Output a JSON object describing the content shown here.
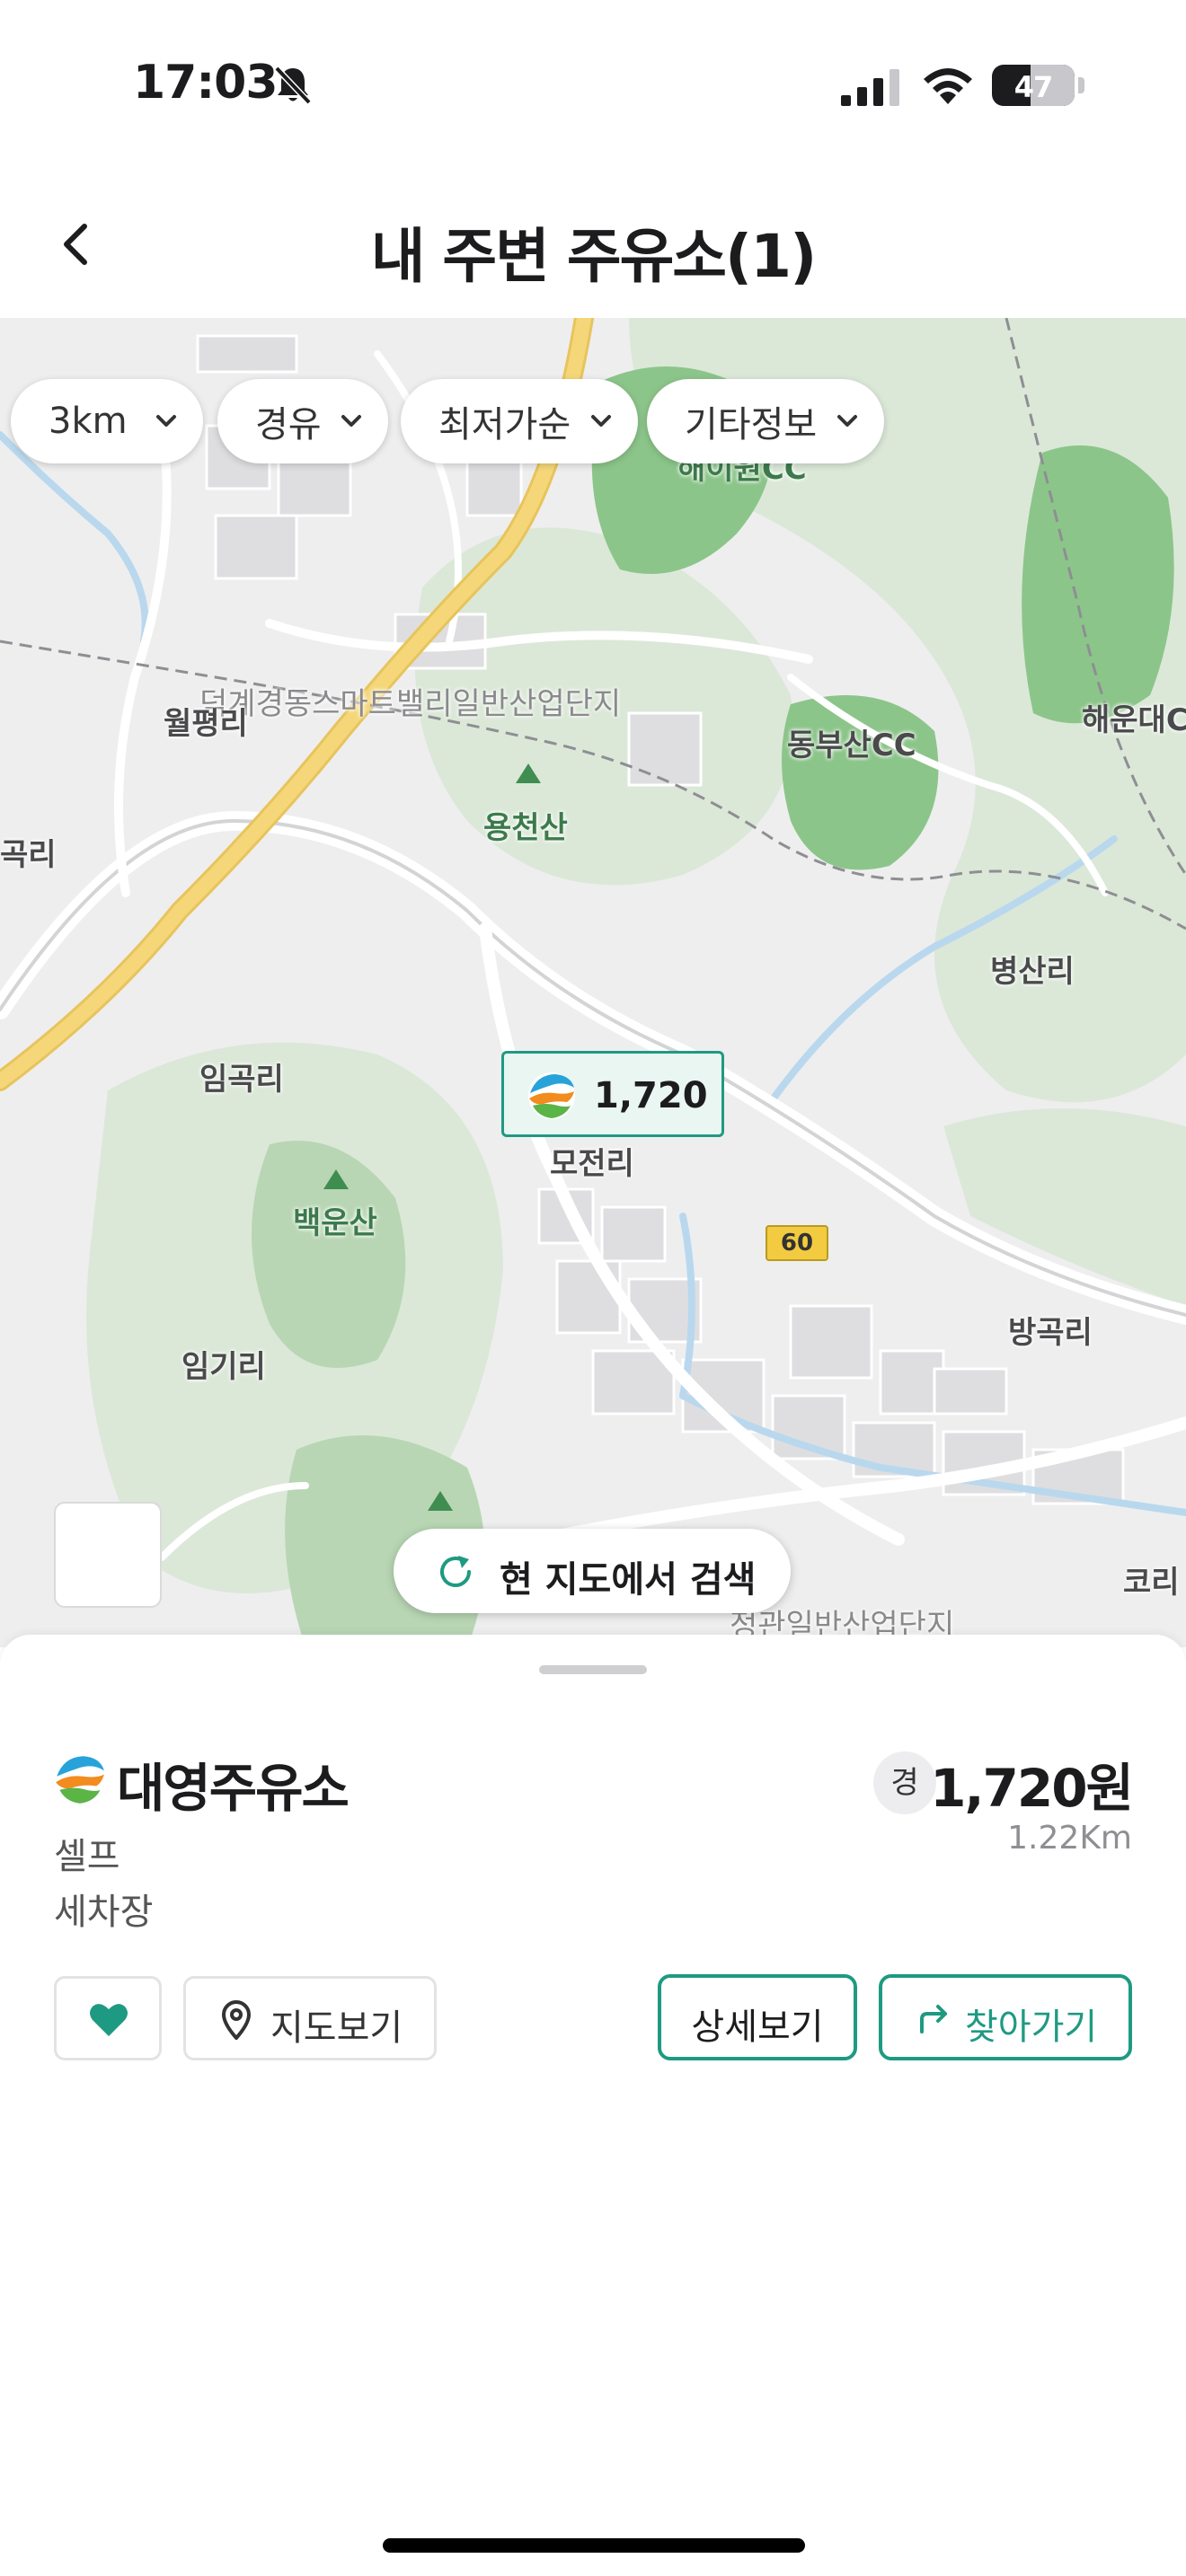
{
  "status_bar": {
    "time": "17:03",
    "battery": "47",
    "battery_level": 0.47,
    "icons": [
      "bell-slash-icon",
      "signal-icon",
      "wifi-icon",
      "battery-icon"
    ]
  },
  "header": {
    "title": "내 주변 주유소(1)",
    "back_icon": "chevron-left-icon"
  },
  "map": {
    "filters": [
      {
        "label": "3km"
      },
      {
        "label": "경유"
      },
      {
        "label": "최저가순"
      },
      {
        "label": "기타정보"
      }
    ],
    "labels": {
      "haeun": "해운대C",
      "deokgye": "덕계경동스마트밸리일반산업단지",
      "wolpyeong": "월평리",
      "dongbusan": "동부산CC",
      "gokri": "곡리",
      "yongcheonsan": "용천산",
      "byeongsanri": "병산리",
      "imgokri": "임곡리",
      "mojeonri": "모전리",
      "baegunsan": "백운산",
      "banggokri": "방곡리",
      "imgiri": "임기리",
      "jeonggwan": "정관일반산업단지",
      "kori": "코리",
      "route": "60"
    },
    "marker": {
      "price": "1,720",
      "logo": "gas-brand-logo"
    },
    "research_button": "현 지도에서 검색",
    "colors": {
      "land": "#eeeeef",
      "park": "#dbe8d8",
      "forest": "#b8d6b4",
      "golf": "#8cc58a",
      "road": "#ffffff",
      "highway": "#f5d77a",
      "water": "#b9d8ee"
    }
  },
  "sheet": {
    "station_name": "대영주유소",
    "type": "셀프",
    "service": "세차장",
    "fuel_badge": "경",
    "price": "1,720원",
    "distance": "1.22Km",
    "buttons": {
      "map_view": "지도보기",
      "detail": "상세보기",
      "navigate": "찾아가기"
    }
  },
  "theme": {
    "accent": "#1f9a82"
  }
}
